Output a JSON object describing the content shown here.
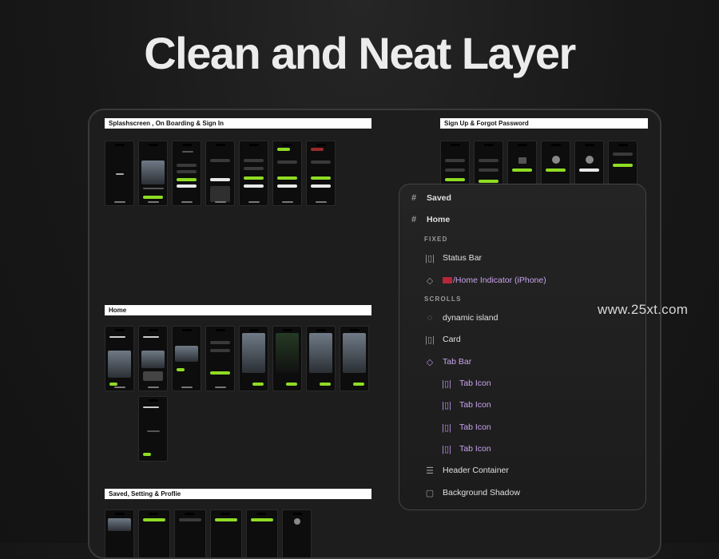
{
  "hero": {
    "title": "Clean and Neat Layer"
  },
  "sections": {
    "splash": "Splashscreen , On Boarding & Sign In",
    "signup": "Sign Up  & Forgot Password",
    "home": "Home",
    "saved": "Saved, Setting & Proflie"
  },
  "layers": {
    "saved": "Saved",
    "home": "Home",
    "fixed_label": "FIXED",
    "status_bar": "Status Bar",
    "home_indicator": "/Home Indicator (iPhone)",
    "scrolls_label": "SCROLLS",
    "dynamic_island": "dynamic island",
    "card": "Card",
    "tab_bar": "Tab Bar",
    "tab_icons": [
      "Tab Icon",
      "Tab Icon",
      "Tab Icon",
      "Tab Icon"
    ],
    "header_container": "Header Container",
    "background_shadow": "Background Shadow"
  },
  "watermark": "www.25xt.com",
  "colors": {
    "accent": "#8fdc24",
    "purple_layer": "#c7a4ec",
    "background": "#181818"
  }
}
